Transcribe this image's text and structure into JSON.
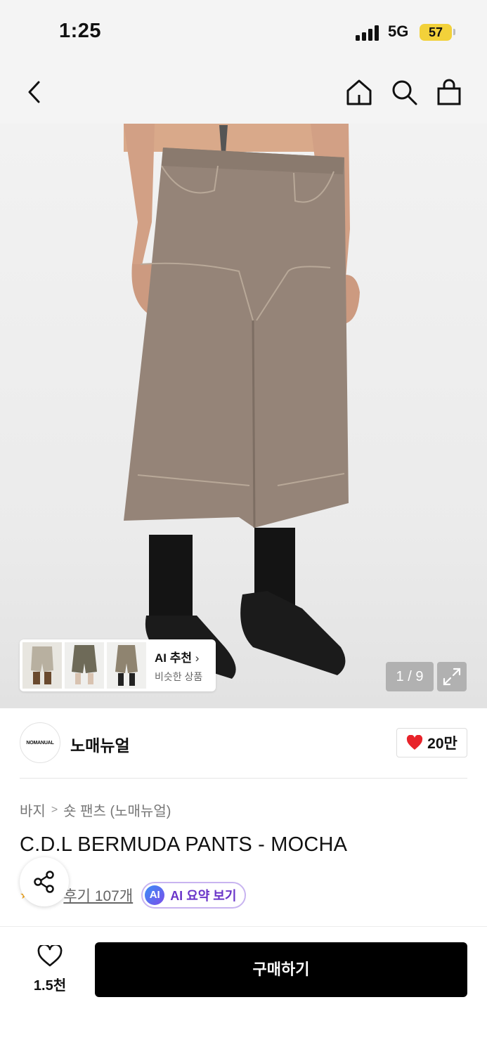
{
  "status_bar": {
    "time": "1:25",
    "network": "5G",
    "battery": "57"
  },
  "nav": {
    "back_icon": "chevron-left-icon",
    "home_icon": "home-icon",
    "search_icon": "search-icon",
    "bag_icon": "shopping-bag-icon"
  },
  "gallery": {
    "ai_recommend_title": "AI 추천",
    "ai_recommend_sub": "비슷한 상품",
    "pager": "1 / 9"
  },
  "brand": {
    "logo_text": "NOMANUAL",
    "name": "노매뉴얼",
    "likes": "20만"
  },
  "product": {
    "breadcrumb": [
      "바지",
      "숏 팬츠 (노매뉴얼)"
    ],
    "title": "C.D.L BERMUDA PANTS - MOCHA",
    "reviews": "후기 107개",
    "ai_badge": "AI",
    "ai_summary": "AI 요약 보기"
  },
  "bottom_bar": {
    "wish_count": "1.5천",
    "buy_label": "구매하기"
  },
  "colors": {
    "accent_red": "#e8232a",
    "buy_button": "#000000",
    "ai_purple": "#6a35c9"
  }
}
